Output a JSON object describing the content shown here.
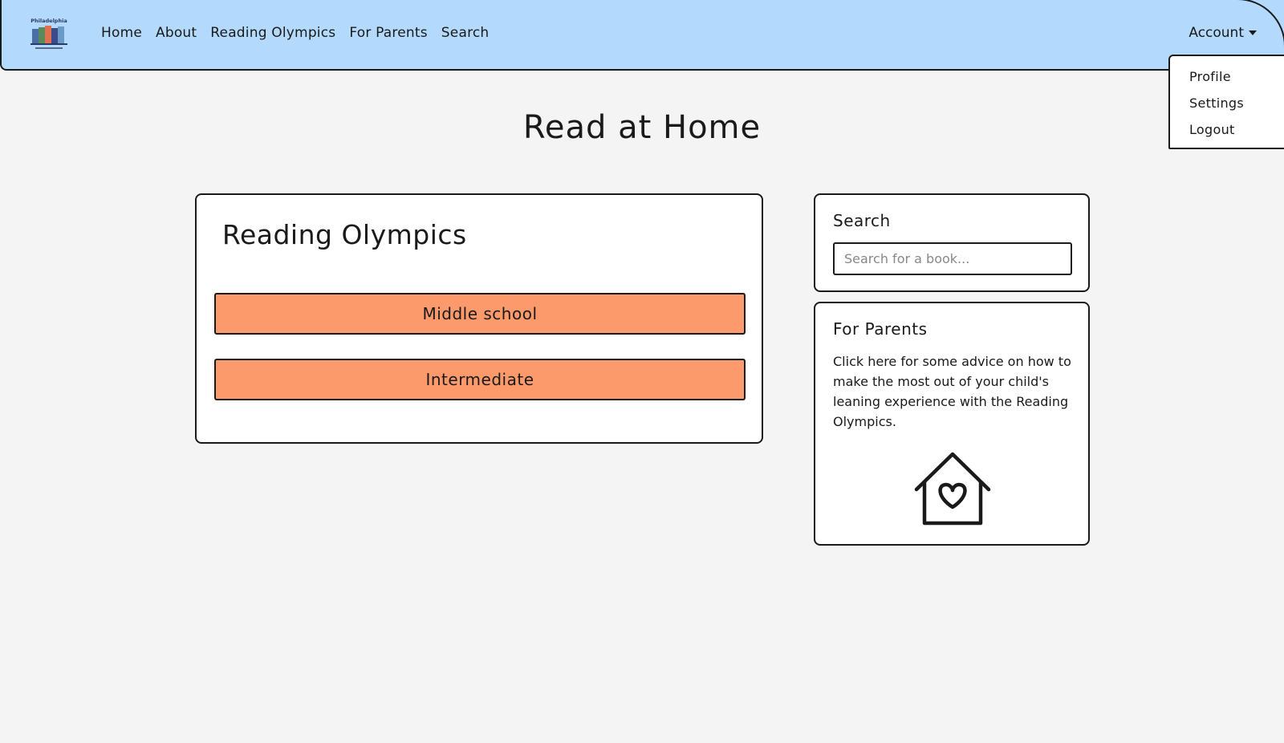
{
  "nav": {
    "logo_text": "Philadelphia",
    "links": [
      "Home",
      "About",
      "Reading Olympics",
      "For Parents",
      "Search"
    ],
    "account_label": "Account",
    "account_menu": [
      "Profile",
      "Settings",
      "Logout"
    ]
  },
  "page": {
    "title": "Read at Home"
  },
  "reading_olympics": {
    "title": "Reading Olympics",
    "levels": [
      "Middle school",
      "Intermediate"
    ]
  },
  "search": {
    "title": "Search",
    "placeholder": "Search for a book..."
  },
  "parents": {
    "title": "For Parents",
    "text": "Click here for some advice on how to make the most out of your child's leaning experience with the Reading Olympics.",
    "icon": "house-heart-icon"
  },
  "colors": {
    "navbar_bg": "#b3d9fc",
    "page_bg": "#f4f4f4",
    "button_bg": "#fc9a6b"
  }
}
